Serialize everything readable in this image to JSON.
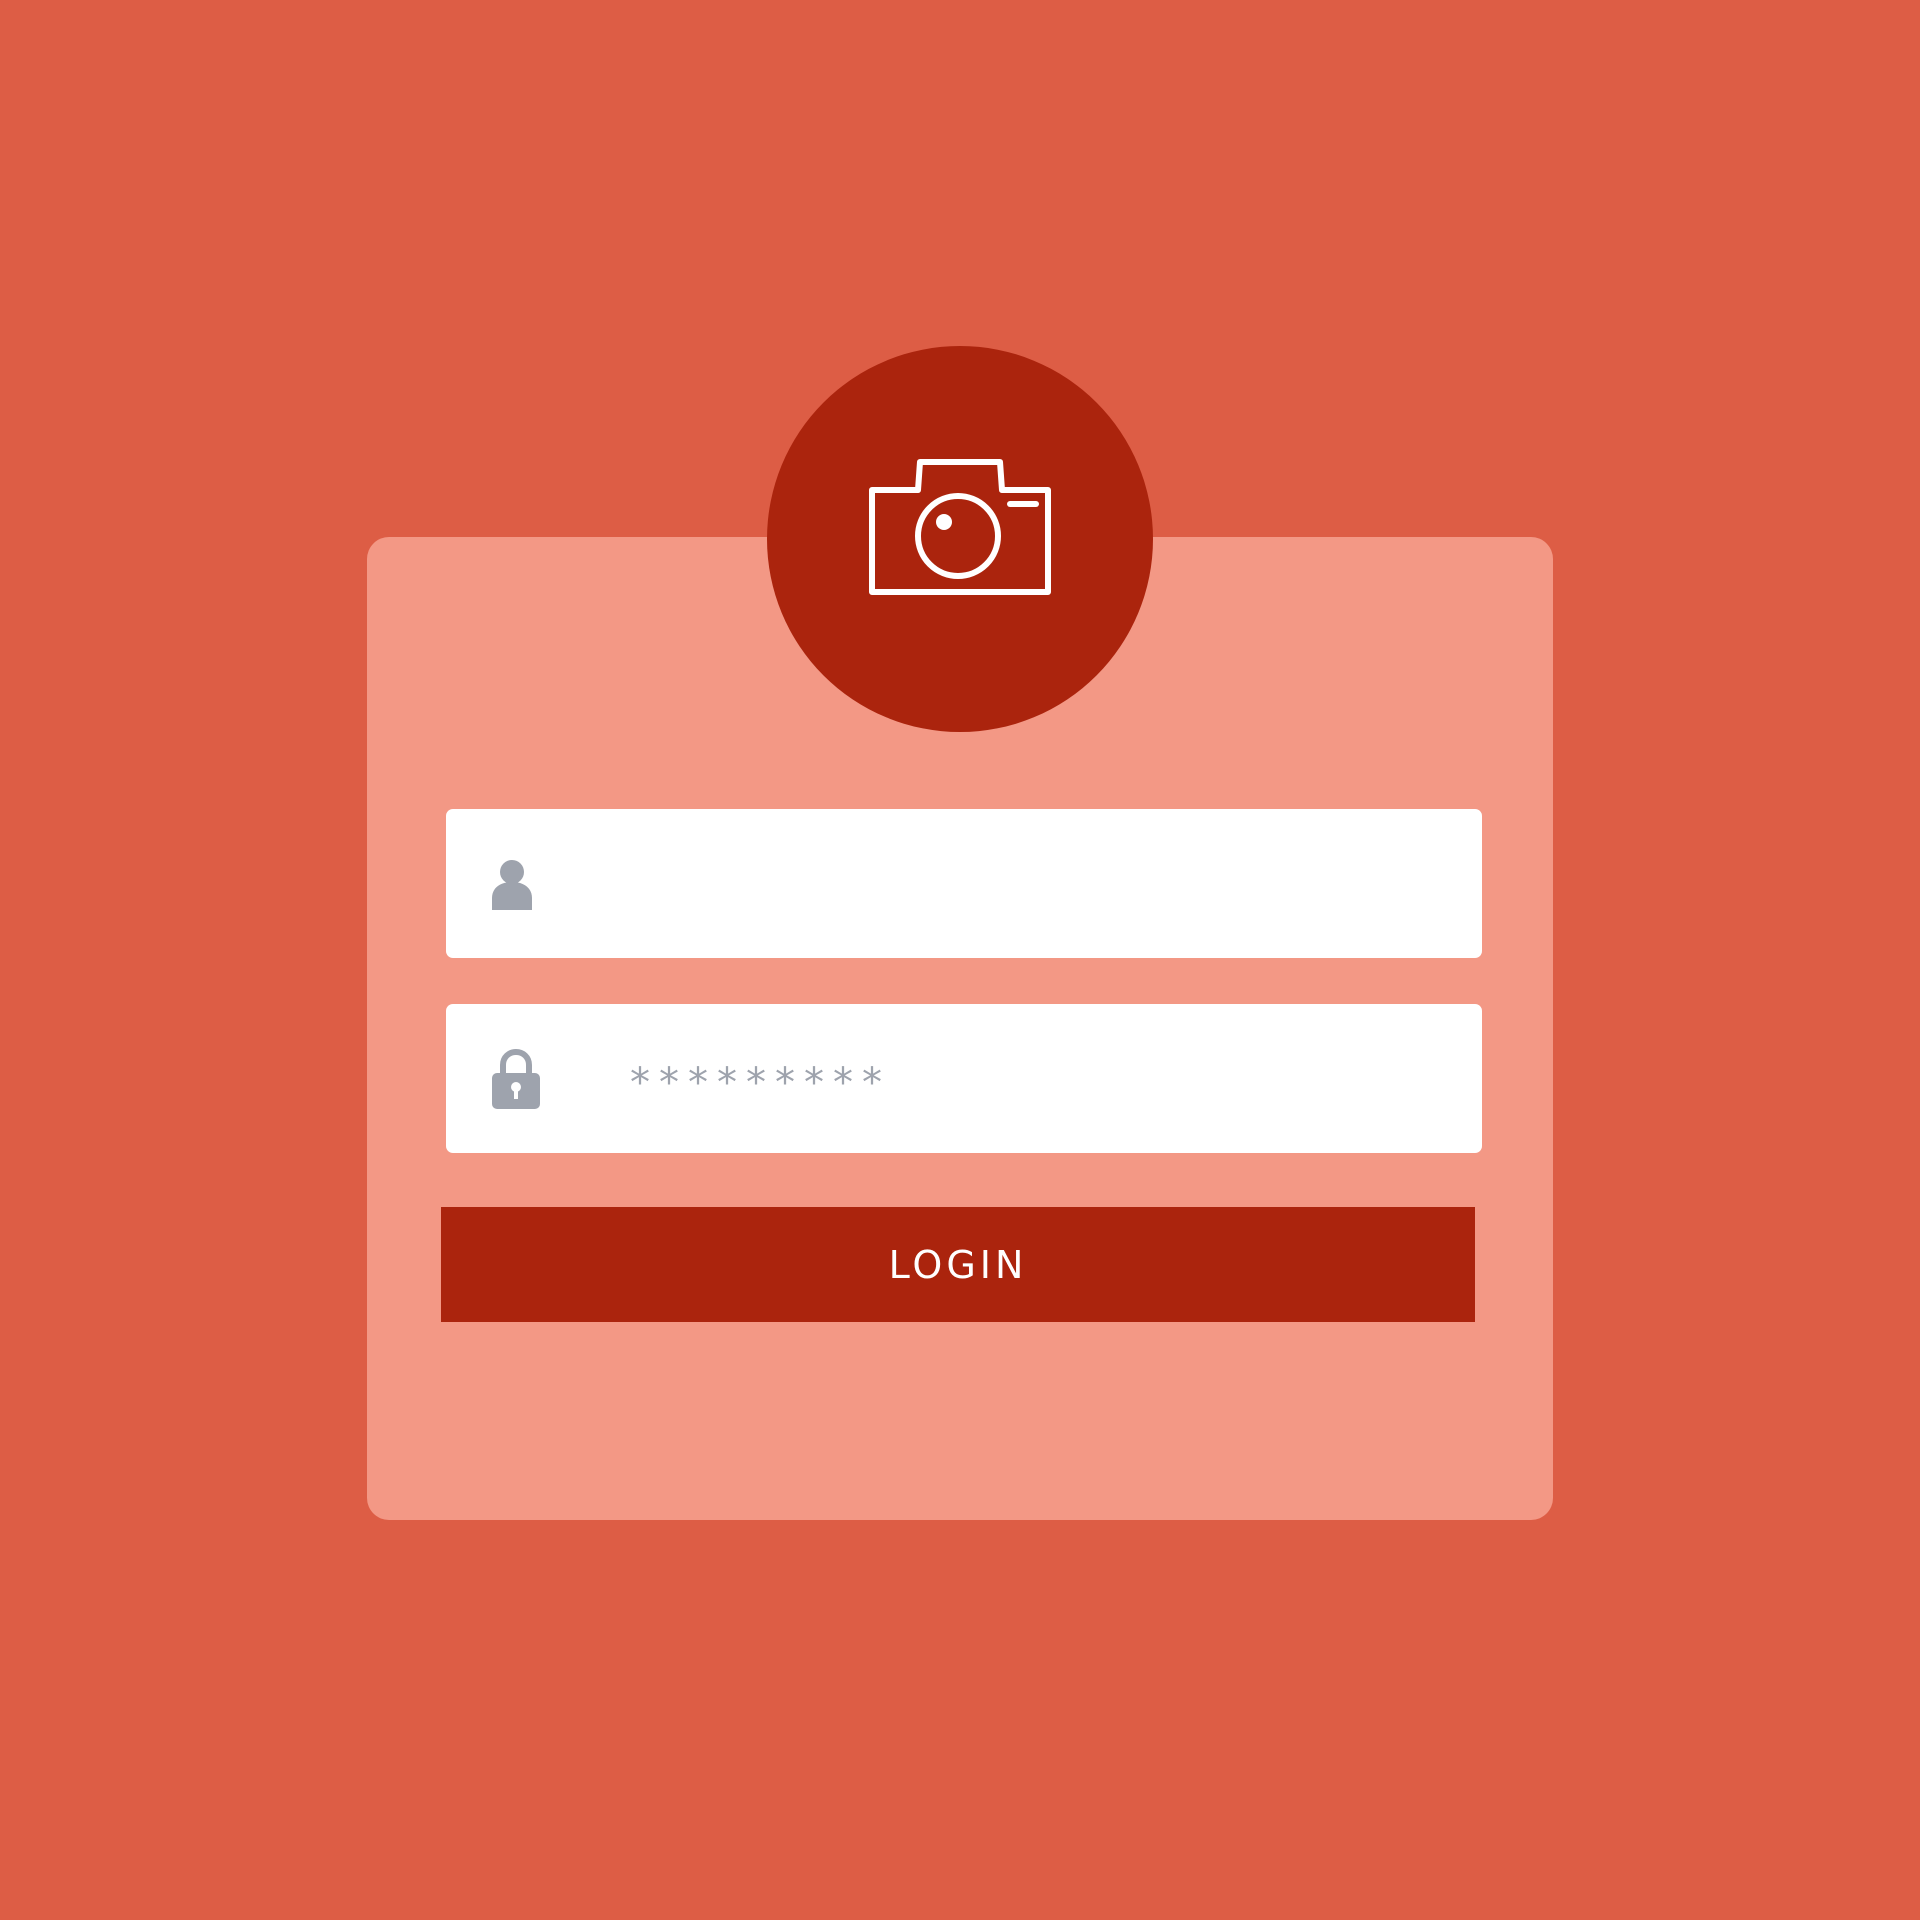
{
  "colors": {
    "background": "#dd5d45",
    "card": "#f39885",
    "accent": "#ab240d",
    "field": "#ffffff",
    "icon_gray": "#9ea3ad"
  },
  "header": {
    "icon": "camera-icon"
  },
  "username_field": {
    "icon": "user-icon",
    "value": ""
  },
  "password_field": {
    "icon": "lock-icon",
    "value": "*********"
  },
  "login_button": {
    "label": "LOGIN"
  }
}
